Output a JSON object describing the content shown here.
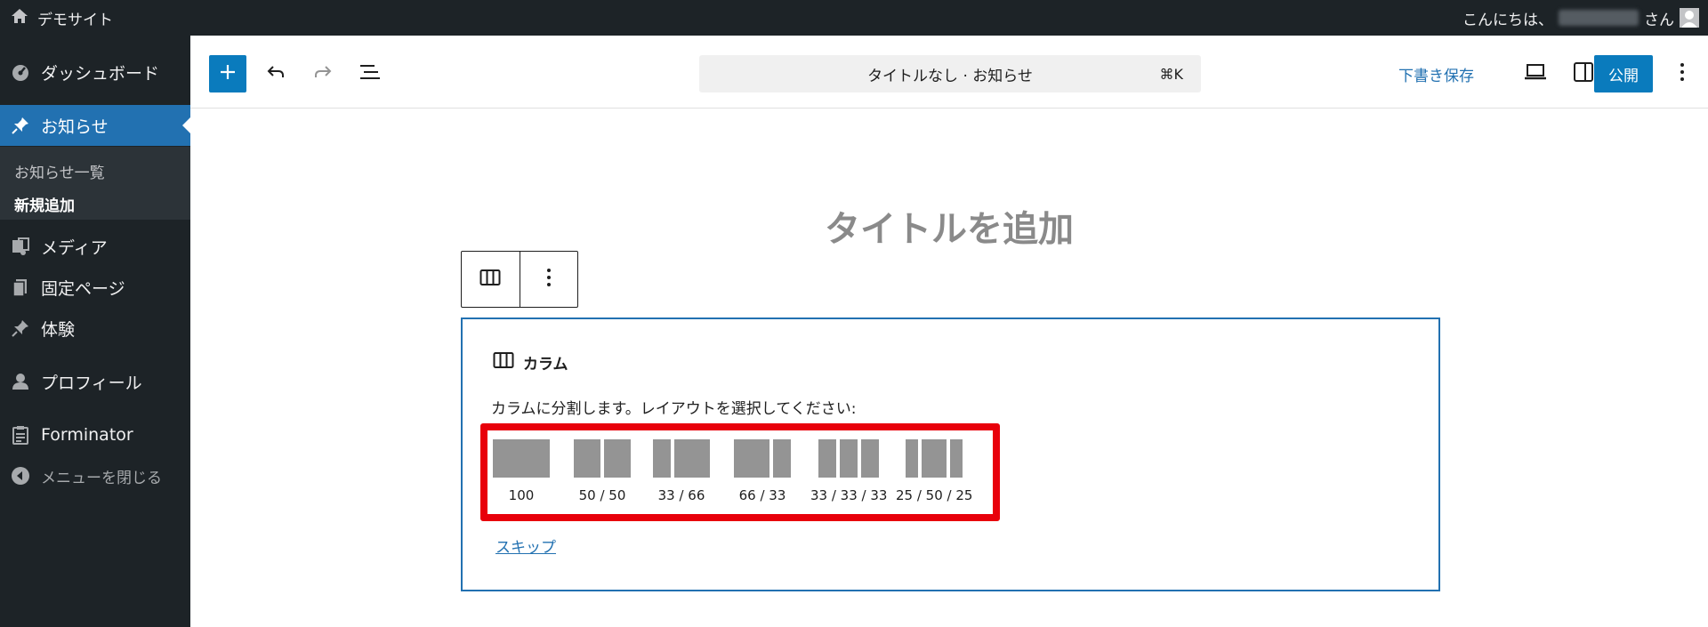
{
  "adminbar": {
    "site_name": "デモサイト",
    "greeting_prefix": "こんにちは、",
    "greeting_suffix": "さん",
    "icons": [
      "home-icon",
      "avatar"
    ]
  },
  "sidebar": {
    "items": [
      {
        "label": "ダッシュボード",
        "icon": "dashboard-icon"
      },
      {
        "label": "お知らせ",
        "icon": "pin-icon",
        "active": true
      },
      {
        "label": "メディア",
        "icon": "media-icon"
      },
      {
        "label": "固定ページ",
        "icon": "page-icon"
      },
      {
        "label": "体験",
        "icon": "pin-icon"
      },
      {
        "label": "プロフィール",
        "icon": "user-icon"
      },
      {
        "label": "Forminator",
        "icon": "clipboard-icon"
      }
    ],
    "submenu": [
      "お知らせ一覧",
      "新規追加"
    ],
    "collapse_label": "メニューを閉じる"
  },
  "header": {
    "command_title": "タイトルなし · お知らせ",
    "command_shortcut": "⌘K",
    "save_draft": "下書き保存",
    "publish": "公開"
  },
  "editor": {
    "title_placeholder": "タイトルを追加",
    "block_name": "カラム",
    "instructions": "カラムに分割します。レイアウトを選択してください:",
    "variations": [
      {
        "label": "100",
        "widths": [
          100
        ]
      },
      {
        "label": "50 / 50",
        "widths": [
          50,
          50
        ]
      },
      {
        "label": "33 / 66",
        "widths": [
          33,
          66
        ]
      },
      {
        "label": "66 / 33",
        "widths": [
          66,
          33
        ]
      },
      {
        "label": "33 / 33 / 33",
        "widths": [
          33,
          33,
          33
        ]
      },
      {
        "label": "25 / 50 / 25",
        "widths": [
          25,
          50,
          25
        ]
      }
    ],
    "skip": "スキップ"
  },
  "colors": {
    "admin_dark": "#1d2327",
    "accent": "#2271b1",
    "primary_button": "#0a7bbd",
    "highlight": "#e8000b"
  }
}
